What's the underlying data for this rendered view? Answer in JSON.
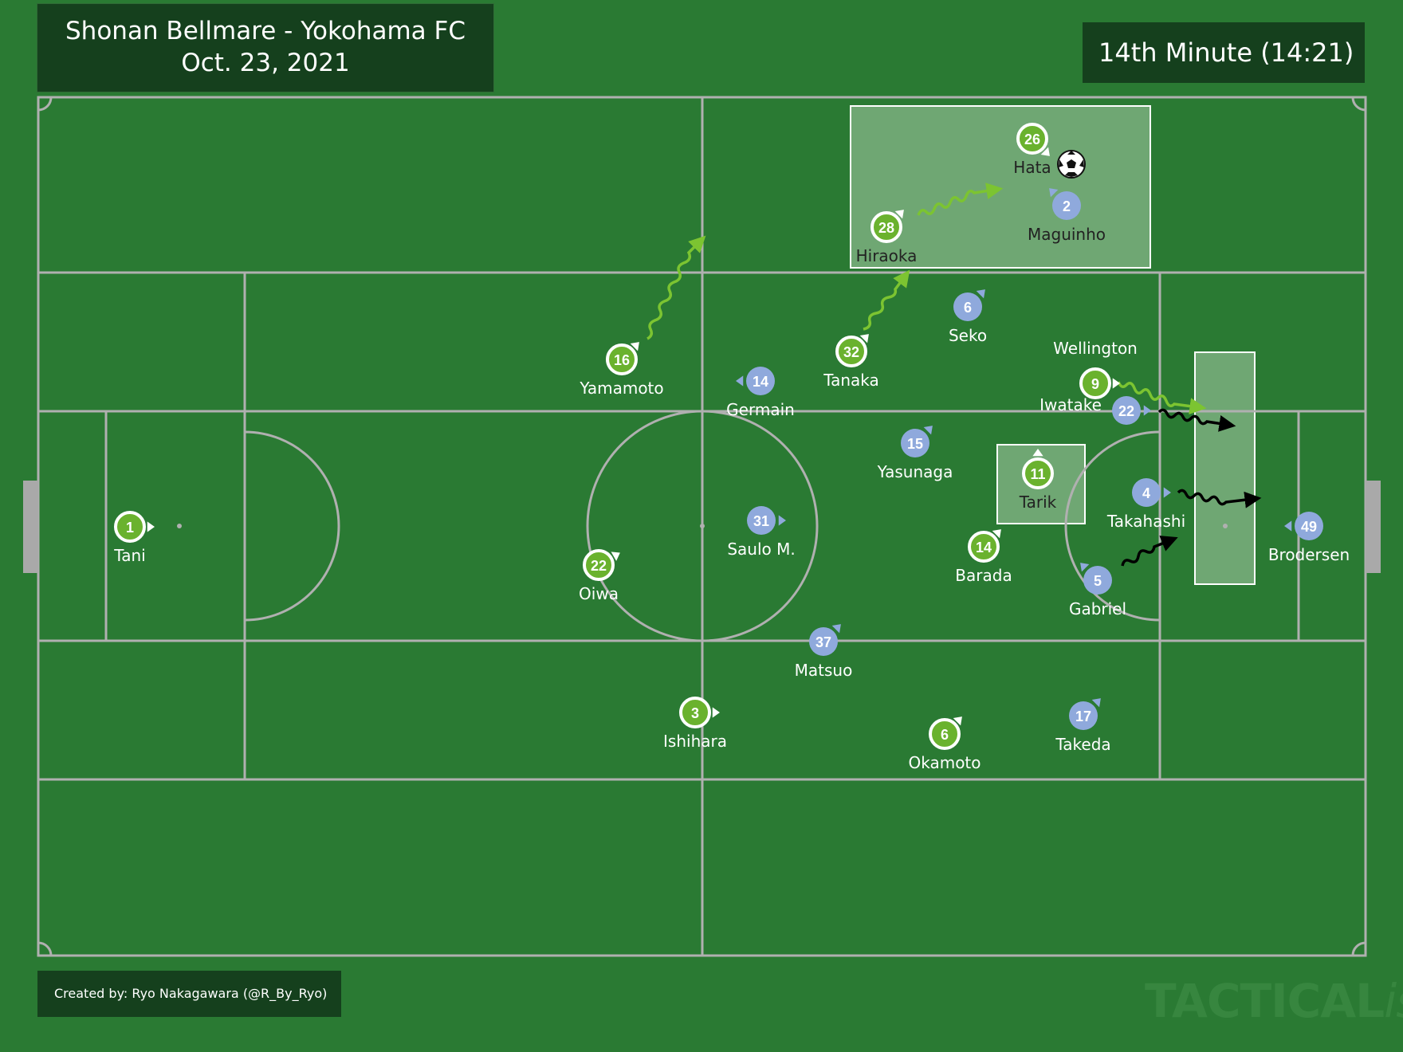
{
  "header": {
    "match": "Shonan Bellmare - Yokohama FC",
    "date": "Oct. 23, 2021",
    "minute": "14th Minute (14:21)"
  },
  "footer": {
    "credit": "Created by: Ryo Nakagawara (@R_By_Ryo)",
    "watermark_main": "TACTICAL",
    "watermark_italic": "ista"
  },
  "colors": {
    "background": "#2a7a33",
    "title_box": "#15401d",
    "home_team": "#6ab22e",
    "away_team": "#8fa9dc",
    "run_home": "#7cc431",
    "run_away": "#000000",
    "highlight_zone": "#8fbf8f",
    "pitch_lines": "#b3b3b3"
  },
  "players": {
    "home": [
      {
        "number": "1",
        "name": "Tani"
      },
      {
        "number": "22",
        "name": "Oiwa"
      },
      {
        "number": "16",
        "name": "Yamamoto"
      },
      {
        "number": "3",
        "name": "Ishihara"
      },
      {
        "number": "28",
        "name": "Hiraoka"
      },
      {
        "number": "26",
        "name": "Hata"
      },
      {
        "number": "32",
        "name": "Tanaka"
      },
      {
        "number": "6",
        "name": "Okamoto"
      },
      {
        "number": "14",
        "name": "Barada"
      },
      {
        "number": "11",
        "name": "Tarik"
      },
      {
        "number": "9",
        "name": "Wellington"
      }
    ],
    "away": [
      {
        "number": "14",
        "name": "Germain"
      },
      {
        "number": "31",
        "name": "Saulo M."
      },
      {
        "number": "37",
        "name": "Matsuo"
      },
      {
        "number": "6",
        "name": "Seko"
      },
      {
        "number": "15",
        "name": "Yasunaga"
      },
      {
        "number": "2",
        "name": "Maguinho"
      },
      {
        "number": "22",
        "name": "Iwatake"
      },
      {
        "number": "4",
        "name": "Takahashi"
      },
      {
        "number": "5",
        "name": "Gabriel"
      },
      {
        "number": "17",
        "name": "Takeda"
      },
      {
        "number": "49",
        "name": "Brodersen"
      }
    ]
  },
  "ball_carrier": "Hata"
}
